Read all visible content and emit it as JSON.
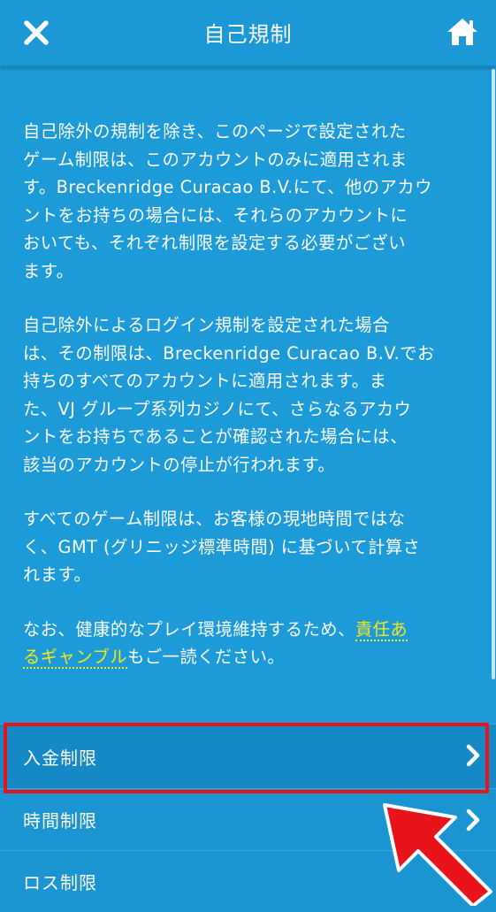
{
  "header": {
    "title": "自己規制",
    "close_icon": "close-icon",
    "home_icon": "home-icon"
  },
  "content": {
    "paragraph1": "自己除外の規制を除き、このページで設定された\nゲーム制限は、このアカウントのみに適用されま\nす。Breckenridge Curacao B.V.にて、他のアカウ\nントをお持ちの場合には、それらのアカウントに\nおいても、それぞれ制限を設定する必要がござい\nます。",
    "paragraph2": "自己除外によるログイン規制を設定された場合\nは、その制限は、Breckenridge Curacao B.V.でお\n持ちのすべてのアカウントに適用されます。ま\nた、VJ グループ系列カジノにて、さらなるアカウ\nントをお持ちであることが確認された場合には、\n該当のアカウントの停止が行われます。",
    "paragraph3": "すべてのゲーム制限は、お客様の現地時間ではな\nく、GMT (グリニッジ標準時間) に基づいて計算さ\nれます。",
    "paragraph4_prefix": "なお、健康的なプレイ環境維持するため、",
    "link_part1": "責任あ",
    "link_part2": "るギャンブル",
    "paragraph4_suffix": "もご一読ください。"
  },
  "menu": {
    "items": [
      {
        "label": "入金制限",
        "icon": "chevron-right-icon"
      },
      {
        "label": "時間制限",
        "icon": "chevron-right-icon"
      },
      {
        "label": "ロス制限",
        "icon": "chevron-right-icon"
      }
    ]
  },
  "colors": {
    "background": "#1d9ad8",
    "link": "#f6e71b",
    "highlight": "#e8141c"
  }
}
